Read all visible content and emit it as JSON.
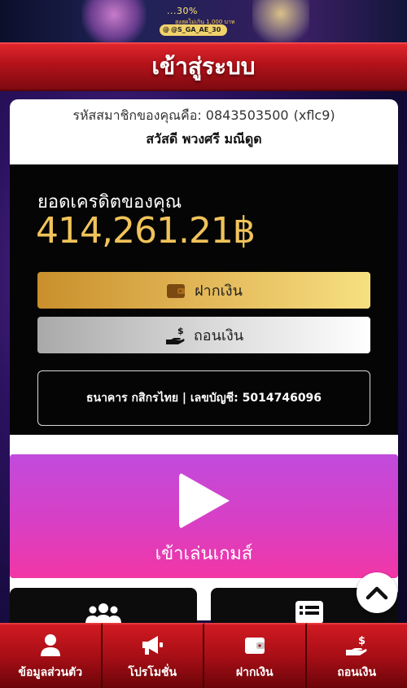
{
  "banner": {
    "promo_text": "...30%",
    "sub_text": "สูงสุดไม่เกิน 1,000 บาท",
    "handle": "@S_GA_AE_30"
  },
  "header": {
    "title": "เข้าสู่ระบบ"
  },
  "member": {
    "id_label": "รหัสสมาชิกของคุณคือ: 0843503500",
    "id_code": "(xflc9)",
    "greeting": "สวัสดี พวงศรี มณีดูด"
  },
  "credit": {
    "label": "ยอดเครดิตของคุณ",
    "amount": "414,261.21฿",
    "amount_color": "#f0c35a"
  },
  "actions": {
    "deposit_label": "ฝากเงิน",
    "withdraw_label": "ถอนเงิน"
  },
  "bank": {
    "info": "ธนาคาร กสิกรไทย | เลขบัญชี: 5014746096"
  },
  "play": {
    "label": "เข้าเล่นเกมส์"
  },
  "bottom_nav": {
    "items": [
      {
        "label": "ข้อมูลส่วนตัว",
        "icon": "user-icon"
      },
      {
        "label": "โปรโมชั่น",
        "icon": "megaphone-icon"
      },
      {
        "label": "ฝากเงิน",
        "icon": "wallet-icon"
      },
      {
        "label": "ถอนเงิน",
        "icon": "hand-money-icon"
      }
    ]
  },
  "colors": {
    "header_red": "#c4161e",
    "play_gradient_top": "#c14bdc",
    "play_gradient_bottom": "#f236a6",
    "deposit_gold": "#e3b758"
  }
}
